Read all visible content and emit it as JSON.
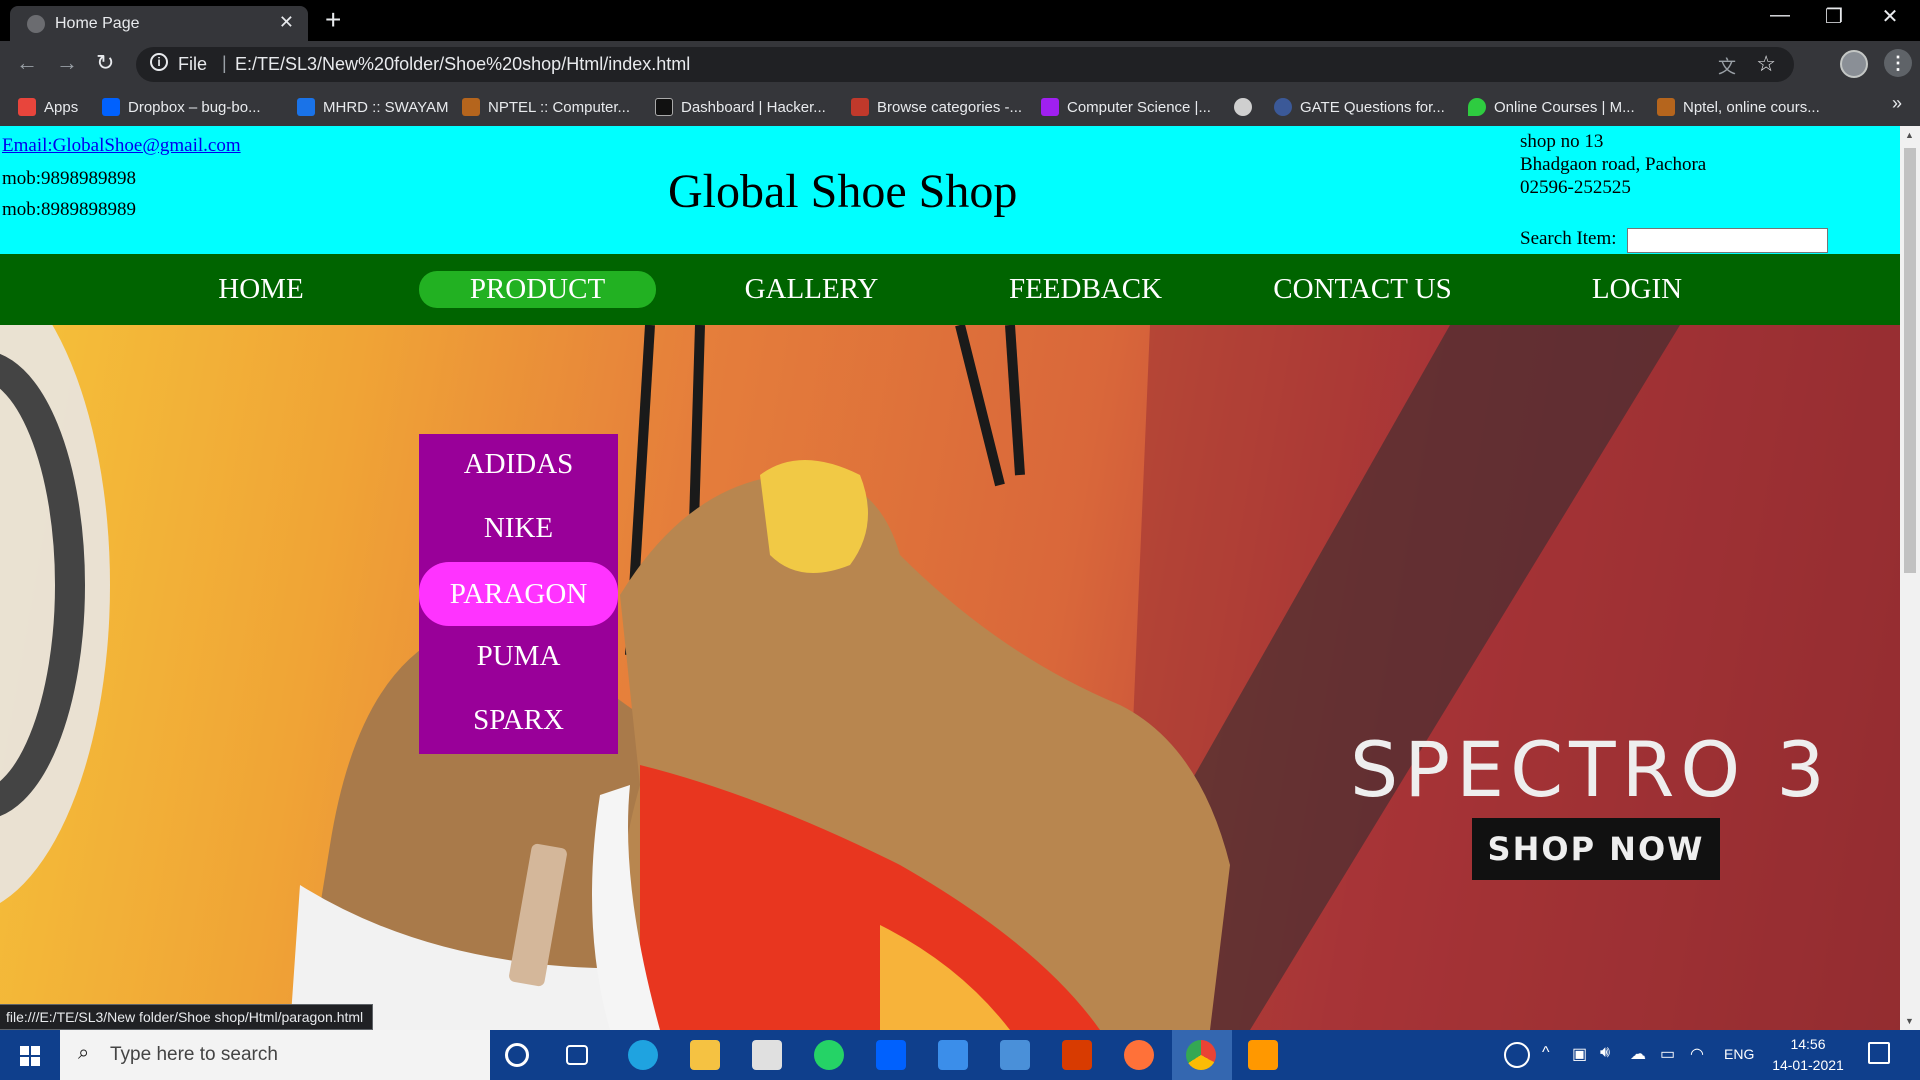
{
  "browser": {
    "tab_title": "Home Page",
    "tab_close": "✕",
    "new_tab": "+",
    "url_scheme": "File",
    "url_separator": "|",
    "url": "E:/TE/SL3/New%20folder/Shoe%20shop/Html/index.html",
    "window_controls": [
      "—",
      "❐",
      "✕"
    ],
    "nav_icons": [
      "back-icon",
      "forward-icon",
      "reload-icon"
    ],
    "bookmarks": [
      {
        "label": "Apps",
        "icon": "apps-grid-icon",
        "color": "#e8453c"
      },
      {
        "label": "Dropbox – bug-bo...",
        "icon": "dropbox-icon",
        "color": "#0061fe"
      },
      {
        "label": "MHRD :: SWAYAM",
        "icon": "swayam-icon",
        "color": "#1a73e8"
      },
      {
        "label": "NPTEL :: Computer...",
        "icon": "nptel-icon",
        "color": "#b5651d"
      },
      {
        "label": "Dashboard | Hacker...",
        "icon": "hackerrank-icon",
        "color": "#111111"
      },
      {
        "label": "Browse categories -...",
        "icon": "category-icon",
        "color": "#c0392b"
      },
      {
        "label": "Computer Science |...",
        "icon": "geeks-icon",
        "color": "#a020f0"
      },
      {
        "label": "",
        "icon": "globe-icon",
        "color": "#cfcfcf"
      },
      {
        "label": "GATE Questions for...",
        "icon": "gate-icon",
        "color": "#3b5998"
      },
      {
        "label": "Online Courses | M...",
        "icon": "leaf-icon",
        "color": "#2ecc40"
      },
      {
        "label": "Nptel, online cours...",
        "icon": "nptel-icon",
        "color": "#b5651d"
      }
    ],
    "bookmarks_more": "»",
    "status_url": "file:///E:/TE/SL3/New folder/Shoe shop/Html/paragon.html"
  },
  "page": {
    "header": {
      "email": "Email:GlobalShoe@gmail.com",
      "mobile_1": "mob:9898989898",
      "mobile_2": "mob:8989898989",
      "title": "Global Shoe Shop",
      "address_line_1": "shop no 13",
      "address_line_2": "Bhadgaon road, Pachora",
      "phone": "02596-252525",
      "search_label": "Search Item:",
      "search_value": ""
    },
    "nav": [
      {
        "label": "HOME",
        "active": false
      },
      {
        "label": "PRODUCT",
        "active": true
      },
      {
        "label": "GALLERY",
        "active": false
      },
      {
        "label": "FEEDBACK",
        "active": false
      },
      {
        "label": "CONTACT US",
        "active": false
      },
      {
        "label": "LOGIN",
        "active": false
      }
    ],
    "product_dropdown": [
      {
        "label": "ADIDAS",
        "hover": false
      },
      {
        "label": "NIKE",
        "hover": false
      },
      {
        "label": "PARAGON",
        "hover": true
      },
      {
        "label": "PUMA",
        "hover": false
      },
      {
        "label": "SPARX",
        "hover": false
      }
    ],
    "hero": {
      "text": "SPECTRO 3",
      "button": "SHOP NOW"
    }
  },
  "colors": {
    "header_bg": "#00ffff",
    "nav_bg": "#006400",
    "nav_active_bg": "#22b122",
    "dropdown_bg": "#990099",
    "dropdown_hover_bg": "#ff33ff",
    "taskbar_bg": "#0f3f8c"
  },
  "taskbar": {
    "search_placeholder": "Type here to search",
    "apps": [
      "cortana-icon",
      "task-view-icon",
      "edge-icon",
      "file-explorer-icon",
      "store-icon",
      "whatsapp-icon",
      "dropbox-icon",
      "vscode-icon",
      "mail-icon",
      "office-icon",
      "firefox-icon",
      "chrome-icon",
      "sublime-text-icon"
    ],
    "tray_language": "ENG",
    "time": "14:56",
    "date": "14-01-2021"
  }
}
